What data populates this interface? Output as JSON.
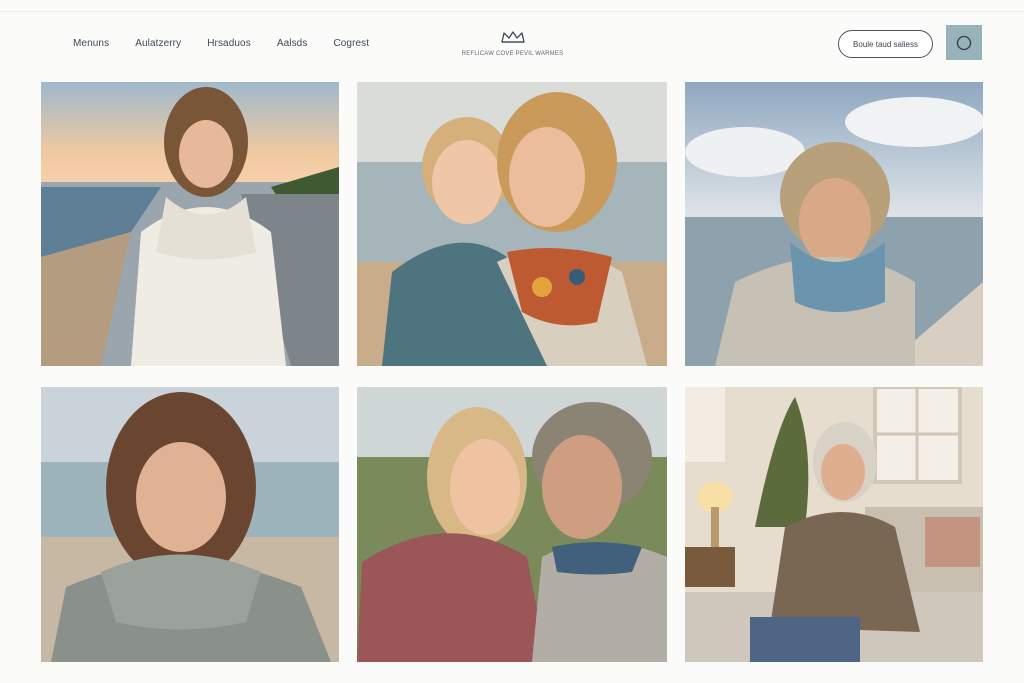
{
  "nav": {
    "items": [
      {
        "label": "Menuns"
      },
      {
        "label": "Aulatzerry"
      },
      {
        "label": "Hrsaduos"
      },
      {
        "label": "Aalsds"
      },
      {
        "label": "Cogrest"
      }
    ]
  },
  "brand": {
    "logo_icon": "crown-logo-icon",
    "tagline": "REFLICAW COVE PEVIL WARMES"
  },
  "header": {
    "cta_label": "Boule taud saliess",
    "search_icon": "search-icon"
  },
  "gallery": {
    "tiles": [
      {
        "subject": "woman-cream-wrap-beach-path"
      },
      {
        "subject": "mother-daughter-teal-wrap-beach"
      },
      {
        "subject": "man-grey-wrap-seaside"
      },
      {
        "subject": "woman-grey-wrap-beach"
      },
      {
        "subject": "father-daughter-rose-wrap"
      },
      {
        "subject": "older-woman-brown-wrap-living-room"
      }
    ]
  },
  "colors": {
    "background": "#fbfbfa",
    "accent": "#97b2b9",
    "text": "#3e4a57"
  }
}
